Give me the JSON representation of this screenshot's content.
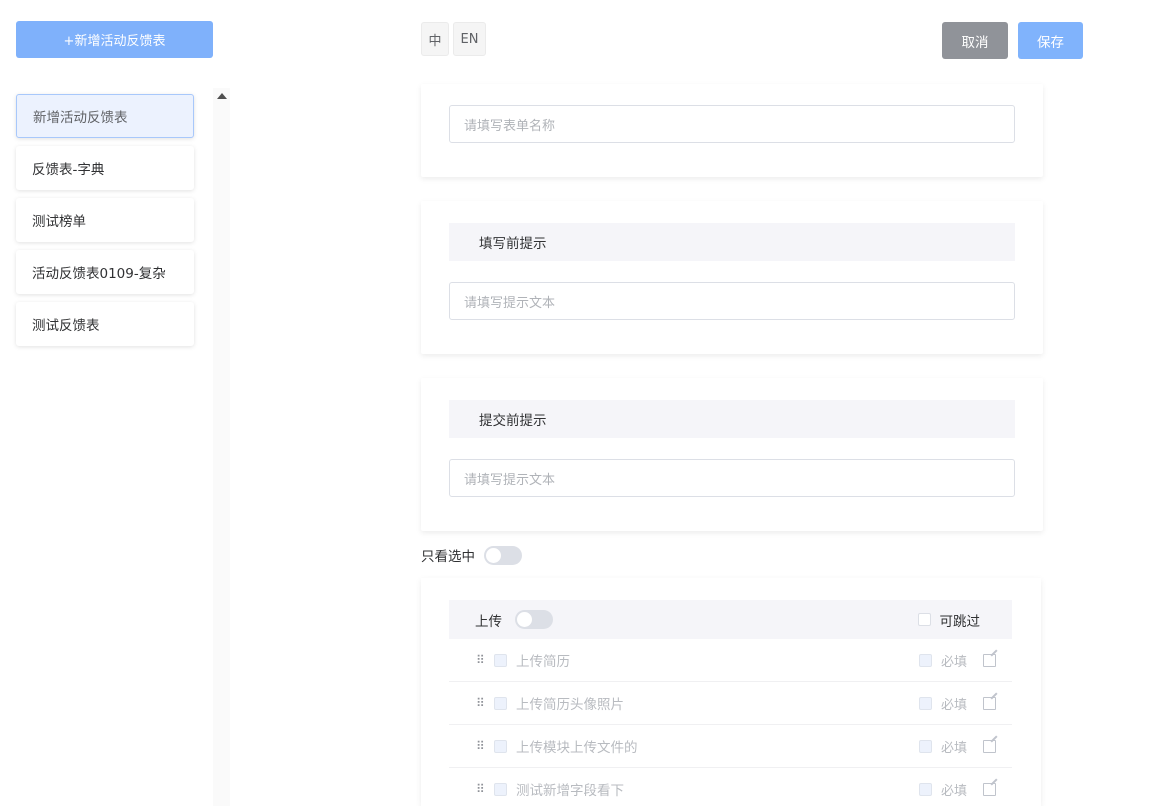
{
  "sidebar": {
    "add_button": "+新增活动反馈表",
    "items": [
      {
        "label": "新增活动反馈表",
        "active": true
      },
      {
        "label": "反馈表-字典",
        "active": false
      },
      {
        "label": "测试榜单",
        "active": false
      },
      {
        "label": "活动反馈表0109-复杂",
        "active": false
      },
      {
        "label": "测试反馈表",
        "active": false
      }
    ]
  },
  "lang": {
    "zh": "中",
    "en": "EN"
  },
  "actions": {
    "cancel": "取消",
    "save": "保存"
  },
  "form": {
    "name_placeholder": "请填写表单名称",
    "before_fill": {
      "title": "填写前提示",
      "placeholder": "请填写提示文本"
    },
    "before_submit": {
      "title": "提交前提示",
      "placeholder": "请填写提示文本"
    },
    "only_checked_label": "只看选中"
  },
  "upload": {
    "title": "上传",
    "skip_label": "可跳过",
    "required_label": "必填",
    "fields": [
      {
        "label": "上传简历"
      },
      {
        "label": "上传简历头像照片"
      },
      {
        "label": "上传模块上传文件的"
      },
      {
        "label": "测试新增字段看下"
      }
    ]
  },
  "colors": {
    "primary_light": "#7fb1fb",
    "cancel_gray": "#909399",
    "section_bg": "#f5f5f9"
  }
}
